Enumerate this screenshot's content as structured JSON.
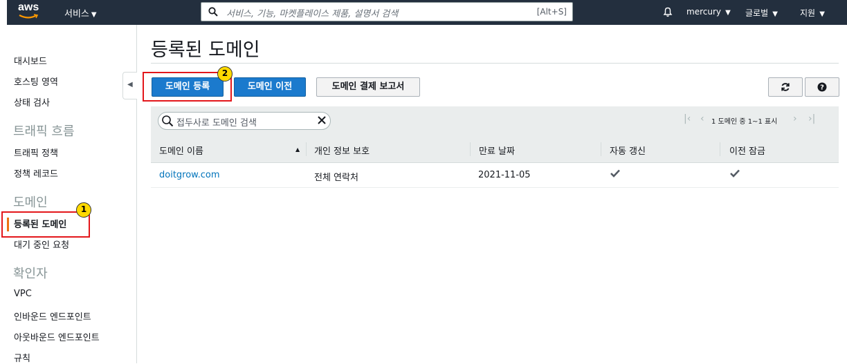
{
  "topbar": {
    "logo_text": "aws",
    "services_label": "서비스",
    "search_placeholder": "서비스, 기능, 마켓플레이스 제품, 설명서 검색",
    "search_shortcut": "[Alt+S]",
    "account_label": "mercury",
    "region_label": "글로벌",
    "support_label": "지원"
  },
  "sidebar": {
    "items": [
      {
        "label": "대시보드"
      },
      {
        "label": "호스팅 영역"
      },
      {
        "label": "상태 검사"
      }
    ],
    "section_traffic": "트래픽 흐름",
    "traffic_items": [
      {
        "label": "트래픽 정책"
      },
      {
        "label": "정책 레코드"
      }
    ],
    "section_domain": "도메인",
    "domain_items": [
      {
        "label": "등록된 도메인",
        "active": true
      },
      {
        "label": "대기 중인 요청"
      }
    ],
    "section_resolver": "확인자",
    "resolver_items": [
      {
        "label": "VPC"
      },
      {
        "label": "인바운드 엔드포인트"
      },
      {
        "label": "아웃바운드 엔드포인트"
      },
      {
        "label": "규칙"
      }
    ]
  },
  "main": {
    "title": "등록된 도메인",
    "buttons": {
      "register": "도메인 등록",
      "transfer": "도메인 이전",
      "billing_report": "도메인 결제 보고서"
    },
    "filter_placeholder": "접두사로 도메인 검색",
    "pager_text": "1 도메인 중 1~1 표시",
    "columns": [
      "도메인 이름",
      "개인 정보 보호",
      "만료 날짜",
      "자동 갱신",
      "이전 잠금"
    ],
    "rows": [
      {
        "domain": "doitgrow.com",
        "privacy": "전체 연락처",
        "expires": "2021-11-05",
        "auto_renew": true,
        "transfer_lock": true
      }
    ]
  },
  "annotations": {
    "badge_1": "1",
    "badge_2": "2"
  },
  "colors": {
    "nav_bg": "#232f3e",
    "primary_button": "#1b7acd",
    "link": "#0073bb",
    "callout": "#e3161a",
    "badge": "#ffd900",
    "active_marker": "#ec7211"
  }
}
